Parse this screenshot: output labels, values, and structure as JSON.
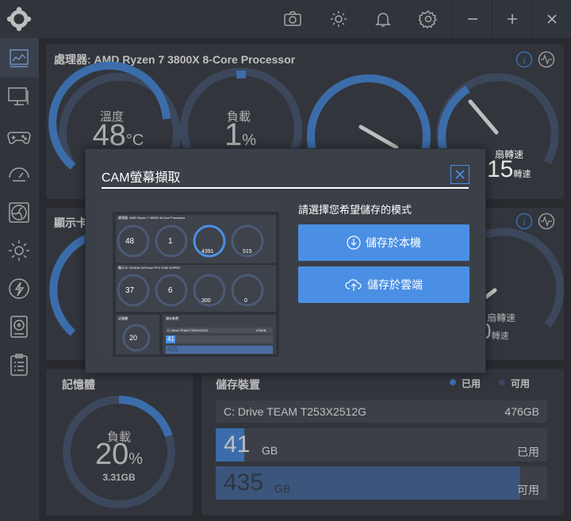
{
  "cpu": {
    "title": "處理器: AMD Ryzen 7 3800X 8-Core Processor",
    "temp_label": "溫度",
    "temp_value": "48",
    "temp_unit": "°C",
    "load_label": "負載",
    "load_value": "1",
    "load_unit": "%",
    "fan_value": "15",
    "fan_unit": "轉速",
    "fan_label_frag": "扇轉速"
  },
  "gpu": {
    "title_frag": "顯示卡",
    "fan_label_frag": "扇轉速",
    "fan_value_frag": "0",
    "fan_unit": "轉速"
  },
  "memory": {
    "title": "記憶體",
    "load_label": "負載",
    "load_value": "20",
    "load_unit": "%",
    "used": "3.31GB",
    "load_percent": 20
  },
  "storage": {
    "title": "儲存裝置",
    "legend_used": "已用",
    "legend_free": "可用",
    "drive_name": "C: Drive TEAM T253X2512G",
    "drive_size": "476GB",
    "used_value": "41",
    "used_unit": "GB",
    "used_label": "已用",
    "free_value": "435",
    "free_unit": "GB",
    "free_label": "可用"
  },
  "modal": {
    "title": "CAM螢幕擷取",
    "prompt": "請選擇您希望儲存的模式",
    "save_local": "儲存於本機",
    "save_cloud": "儲存於雲端",
    "preview": {
      "cpu_title": "處理器: AMD Ryzen 7 3800X 8-Core Processor",
      "gpu_title": "顯示卡: NVIDIA GeForce RTX 2080 SUPER",
      "cpu_temp": "48",
      "cpu_load": "1",
      "cpu_clock": "4391",
      "cpu_fan": "515",
      "gpu_temp": "37",
      "gpu_load": "6",
      "gpu_clock": "300",
      "gpu_fan": "0",
      "mem_title": "記憶體",
      "mem_load": "20",
      "storage_title": "儲存裝置",
      "drive_name": "C: Drive TEAM T253X2512G",
      "drive_size": "476GB",
      "used": "41",
      "free": "435"
    }
  },
  "colors": {
    "accent": "#4a8fe4",
    "track": "#4b5a75",
    "panel": "#3e424a"
  }
}
